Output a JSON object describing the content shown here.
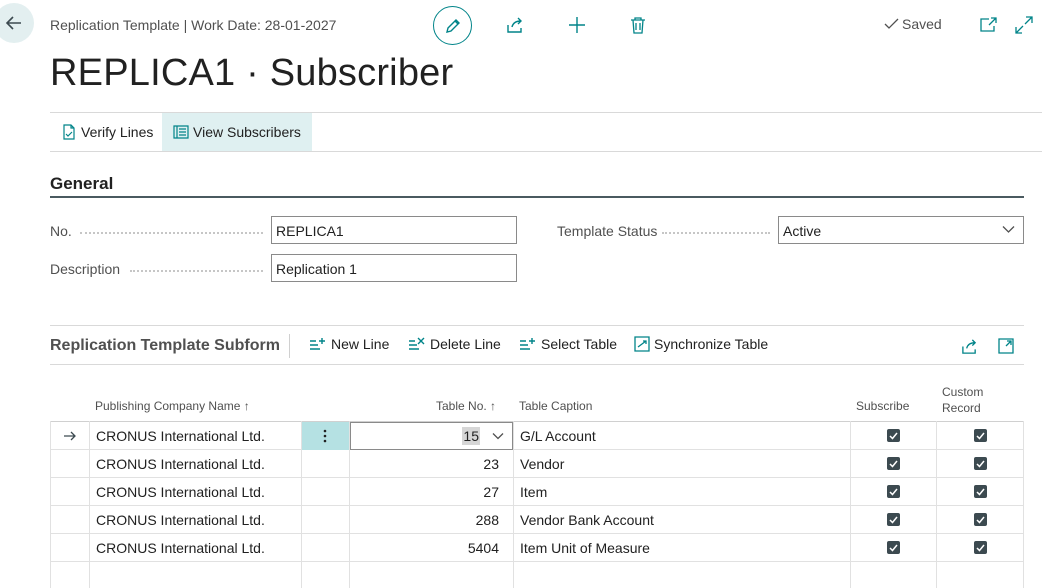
{
  "header": {
    "breadcrumb": "Replication Template | Work Date: 28-01-2027",
    "saved_label": "Saved",
    "page_title": "REPLICA1 · Subscriber"
  },
  "actions": [
    {
      "label": "Verify Lines",
      "icon": "verify-document-icon"
    },
    {
      "label": "View Subscribers",
      "icon": "subscribers-list-icon"
    }
  ],
  "general": {
    "title": "General",
    "no_label": "No.",
    "no_value": "REPLICA1",
    "description_label": "Description",
    "description_value": "Replication 1",
    "template_status_label": "Template Status",
    "template_status_value": "Active"
  },
  "subform": {
    "title": "Replication Template Subform",
    "buttons": [
      {
        "label": "New Line",
        "icon": "new-line-icon"
      },
      {
        "label": "Delete Line",
        "icon": "delete-line-icon"
      },
      {
        "label": "Select Table",
        "icon": "select-table-icon"
      },
      {
        "label": "Synchronize Table",
        "icon": "synchronize-icon"
      }
    ],
    "columns": {
      "publishing_company": "Publishing Company Name",
      "table_no": "Table No.",
      "table_caption": "Table Caption",
      "subscribe": "Subscribe",
      "custom_record_1": "Custom",
      "custom_record_2": "Record"
    },
    "sort_arrow": "↑",
    "rows": [
      {
        "company": "CRONUS International Ltd.",
        "table_no": "15",
        "caption": "G/L Account",
        "subscribe": true,
        "custom": true
      },
      {
        "company": "CRONUS International Ltd.",
        "table_no": "23",
        "caption": "Vendor",
        "subscribe": true,
        "custom": true
      },
      {
        "company": "CRONUS International Ltd.",
        "table_no": "27",
        "caption": "Item",
        "subscribe": true,
        "custom": true
      },
      {
        "company": "CRONUS International Ltd.",
        "table_no": "288",
        "caption": "Vendor Bank Account",
        "subscribe": true,
        "custom": true
      },
      {
        "company": "CRONUS International Ltd.",
        "table_no": "5404",
        "caption": "Item Unit of Measure",
        "subscribe": true,
        "custom": true
      }
    ]
  },
  "colors": {
    "accent": "#008489",
    "active_tab_bg": "#dff0f1",
    "selected_cell_bg": "#b5e1e3"
  }
}
